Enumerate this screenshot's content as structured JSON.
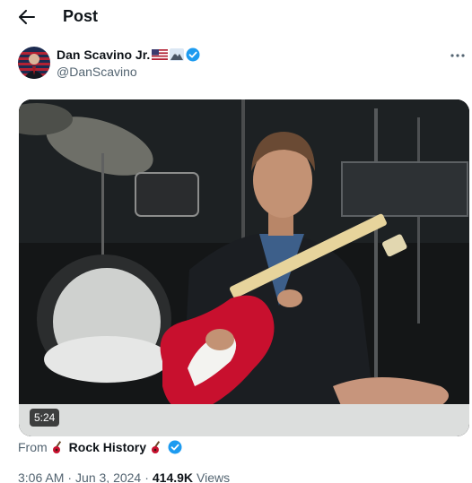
{
  "header": {
    "title": "Post"
  },
  "author": {
    "name": "Dan Scavino Jr.",
    "handle": "@DanScavino",
    "name_emojis": [
      "us-flag-icon",
      "mountain-icon"
    ],
    "verified": true
  },
  "media": {
    "duration": "5:24"
  },
  "source": {
    "prefix": "From",
    "name": "Rock History",
    "verified": true
  },
  "meta": {
    "time": "3:06 AM",
    "date": "Jun 3, 2024",
    "views": "414.9K",
    "views_label": "Views",
    "separator": "·"
  },
  "colors": {
    "verified": "#1d9bf0",
    "text": "#0f1419",
    "muted": "#536471",
    "guitar": "#c8102e"
  }
}
